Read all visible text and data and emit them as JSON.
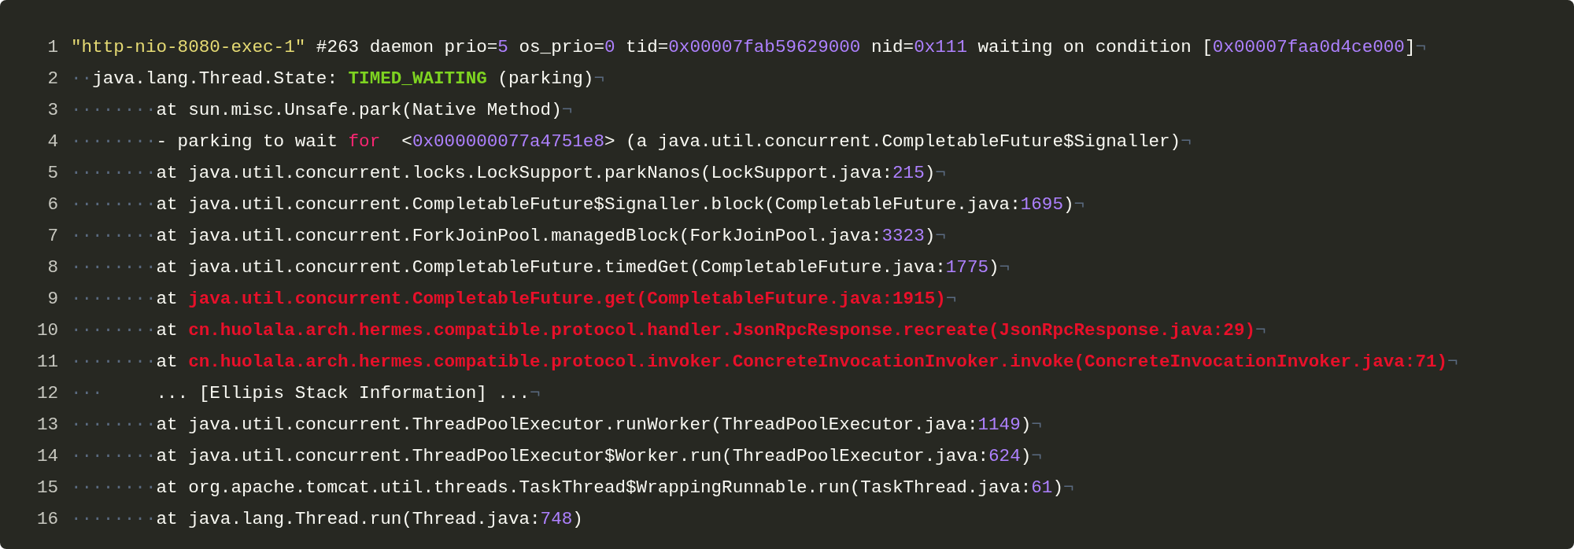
{
  "editor": {
    "lines": [
      {
        "number": "1",
        "tokens": [
          {
            "kind": "string",
            "text": "\"http-nio-8080-exec-1\""
          },
          {
            "kind": "plain",
            "text": " #263 daemon prio="
          },
          {
            "kind": "number",
            "text": "5"
          },
          {
            "kind": "plain",
            "text": " os_prio="
          },
          {
            "kind": "number",
            "text": "0"
          },
          {
            "kind": "plain",
            "text": " tid="
          },
          {
            "kind": "number",
            "text": "0x00007fab59629000"
          },
          {
            "kind": "plain",
            "text": " nid="
          },
          {
            "kind": "number",
            "text": "0x111"
          },
          {
            "kind": "plain",
            "text": " waiting on condition ["
          },
          {
            "kind": "number",
            "text": "0x00007faa0d4ce000"
          },
          {
            "kind": "plain",
            "text": "]"
          }
        ],
        "eol": "¬"
      },
      {
        "number": "2",
        "indent": "··",
        "tokens": [
          {
            "kind": "plain",
            "text": "java.lang.Thread.State: "
          },
          {
            "kind": "state",
            "text": "TIMED_WAITING"
          },
          {
            "kind": "plain",
            "text": " (parking)"
          }
        ],
        "eol": "¬"
      },
      {
        "number": "3",
        "indent": "········",
        "tokens": [
          {
            "kind": "plain",
            "text": "at sun.misc.Unsafe.park(Native Method)"
          }
        ],
        "eol": "¬"
      },
      {
        "number": "4",
        "indent": "········",
        "tokens": [
          {
            "kind": "plain",
            "text": "- parking to wait "
          },
          {
            "kind": "keyword",
            "text": "for"
          },
          {
            "kind": "plain",
            "text": "  <"
          },
          {
            "kind": "number",
            "text": "0x000000077a4751e8"
          },
          {
            "kind": "plain",
            "text": "> (a java.util.concurrent.CompletableFuture$Signaller)"
          }
        ],
        "eol": "¬"
      },
      {
        "number": "5",
        "indent": "········",
        "tokens": [
          {
            "kind": "plain",
            "text": "at java.util.concurrent.locks.LockSupport.parkNanos(LockSupport.java:"
          },
          {
            "kind": "number",
            "text": "215"
          },
          {
            "kind": "plain",
            "text": ")"
          }
        ],
        "eol": "¬"
      },
      {
        "number": "6",
        "indent": "········",
        "tokens": [
          {
            "kind": "plain",
            "text": "at java.util.concurrent.CompletableFuture$Signaller.block(CompletableFuture.java:"
          },
          {
            "kind": "number",
            "text": "1695"
          },
          {
            "kind": "plain",
            "text": ")"
          }
        ],
        "eol": "¬"
      },
      {
        "number": "7",
        "indent": "········",
        "tokens": [
          {
            "kind": "plain",
            "text": "at java.util.concurrent.ForkJoinPool.managedBlock(ForkJoinPool.java:"
          },
          {
            "kind": "number",
            "text": "3323"
          },
          {
            "kind": "plain",
            "text": ")"
          }
        ],
        "eol": "¬"
      },
      {
        "number": "8",
        "indent": "········",
        "tokens": [
          {
            "kind": "plain",
            "text": "at java.util.concurrent.CompletableFuture.timedGet(CompletableFuture.java:"
          },
          {
            "kind": "number",
            "text": "1775"
          },
          {
            "kind": "plain",
            "text": ")"
          }
        ],
        "eol": "¬"
      },
      {
        "number": "9",
        "indent": "········",
        "tokens": [
          {
            "kind": "plain",
            "text": "at "
          },
          {
            "kind": "error",
            "text": "java.util.concurrent.CompletableFuture.get(CompletableFuture.java:1915)"
          }
        ],
        "eol": "¬"
      },
      {
        "number": "10",
        "indent": "········",
        "tokens": [
          {
            "kind": "plain",
            "text": "at "
          },
          {
            "kind": "error",
            "text": "cn.huolala.arch.hermes.compatible.protocol.handler.JsonRpcResponse.recreate(JsonRpcResponse.java:29)"
          }
        ],
        "eol": "¬"
      },
      {
        "number": "11",
        "indent": "········",
        "tokens": [
          {
            "kind": "plain",
            "text": "at "
          },
          {
            "kind": "error",
            "text": "cn.huolala.arch.hermes.compatible.protocol.invoker.ConcreteInvocationInvoker.invoke(ConcreteInvocationInvoker.java:71)"
          }
        ],
        "eol": "¬"
      },
      {
        "number": "12",
        "indent": "···     ",
        "tokens": [
          {
            "kind": "plain",
            "text": "... [Ellipis Stack Information] ..."
          }
        ],
        "eol": "¬"
      },
      {
        "number": "13",
        "indent": "········",
        "tokens": [
          {
            "kind": "plain",
            "text": "at java.util.concurrent.ThreadPoolExecutor.runWorker(ThreadPoolExecutor.java:"
          },
          {
            "kind": "number",
            "text": "1149"
          },
          {
            "kind": "plain",
            "text": ")"
          }
        ],
        "eol": "¬"
      },
      {
        "number": "14",
        "indent": "········",
        "tokens": [
          {
            "kind": "plain",
            "text": "at java.util.concurrent.ThreadPoolExecutor$Worker.run(ThreadPoolExecutor.java:"
          },
          {
            "kind": "number",
            "text": "624"
          },
          {
            "kind": "plain",
            "text": ")"
          }
        ],
        "eol": "¬"
      },
      {
        "number": "15",
        "indent": "········",
        "tokens": [
          {
            "kind": "plain",
            "text": "at org.apache.tomcat.util.threads.TaskThread$WrappingRunnable.run(TaskThread.java:"
          },
          {
            "kind": "number",
            "text": "61"
          },
          {
            "kind": "plain",
            "text": ")"
          }
        ],
        "eol": "¬"
      },
      {
        "number": "16",
        "indent": "········",
        "tokens": [
          {
            "kind": "plain",
            "text": "at java.lang.Thread.run(Thread.java:"
          },
          {
            "kind": "number",
            "text": "748"
          },
          {
            "kind": "plain",
            "text": ")"
          }
        ]
      }
    ]
  }
}
